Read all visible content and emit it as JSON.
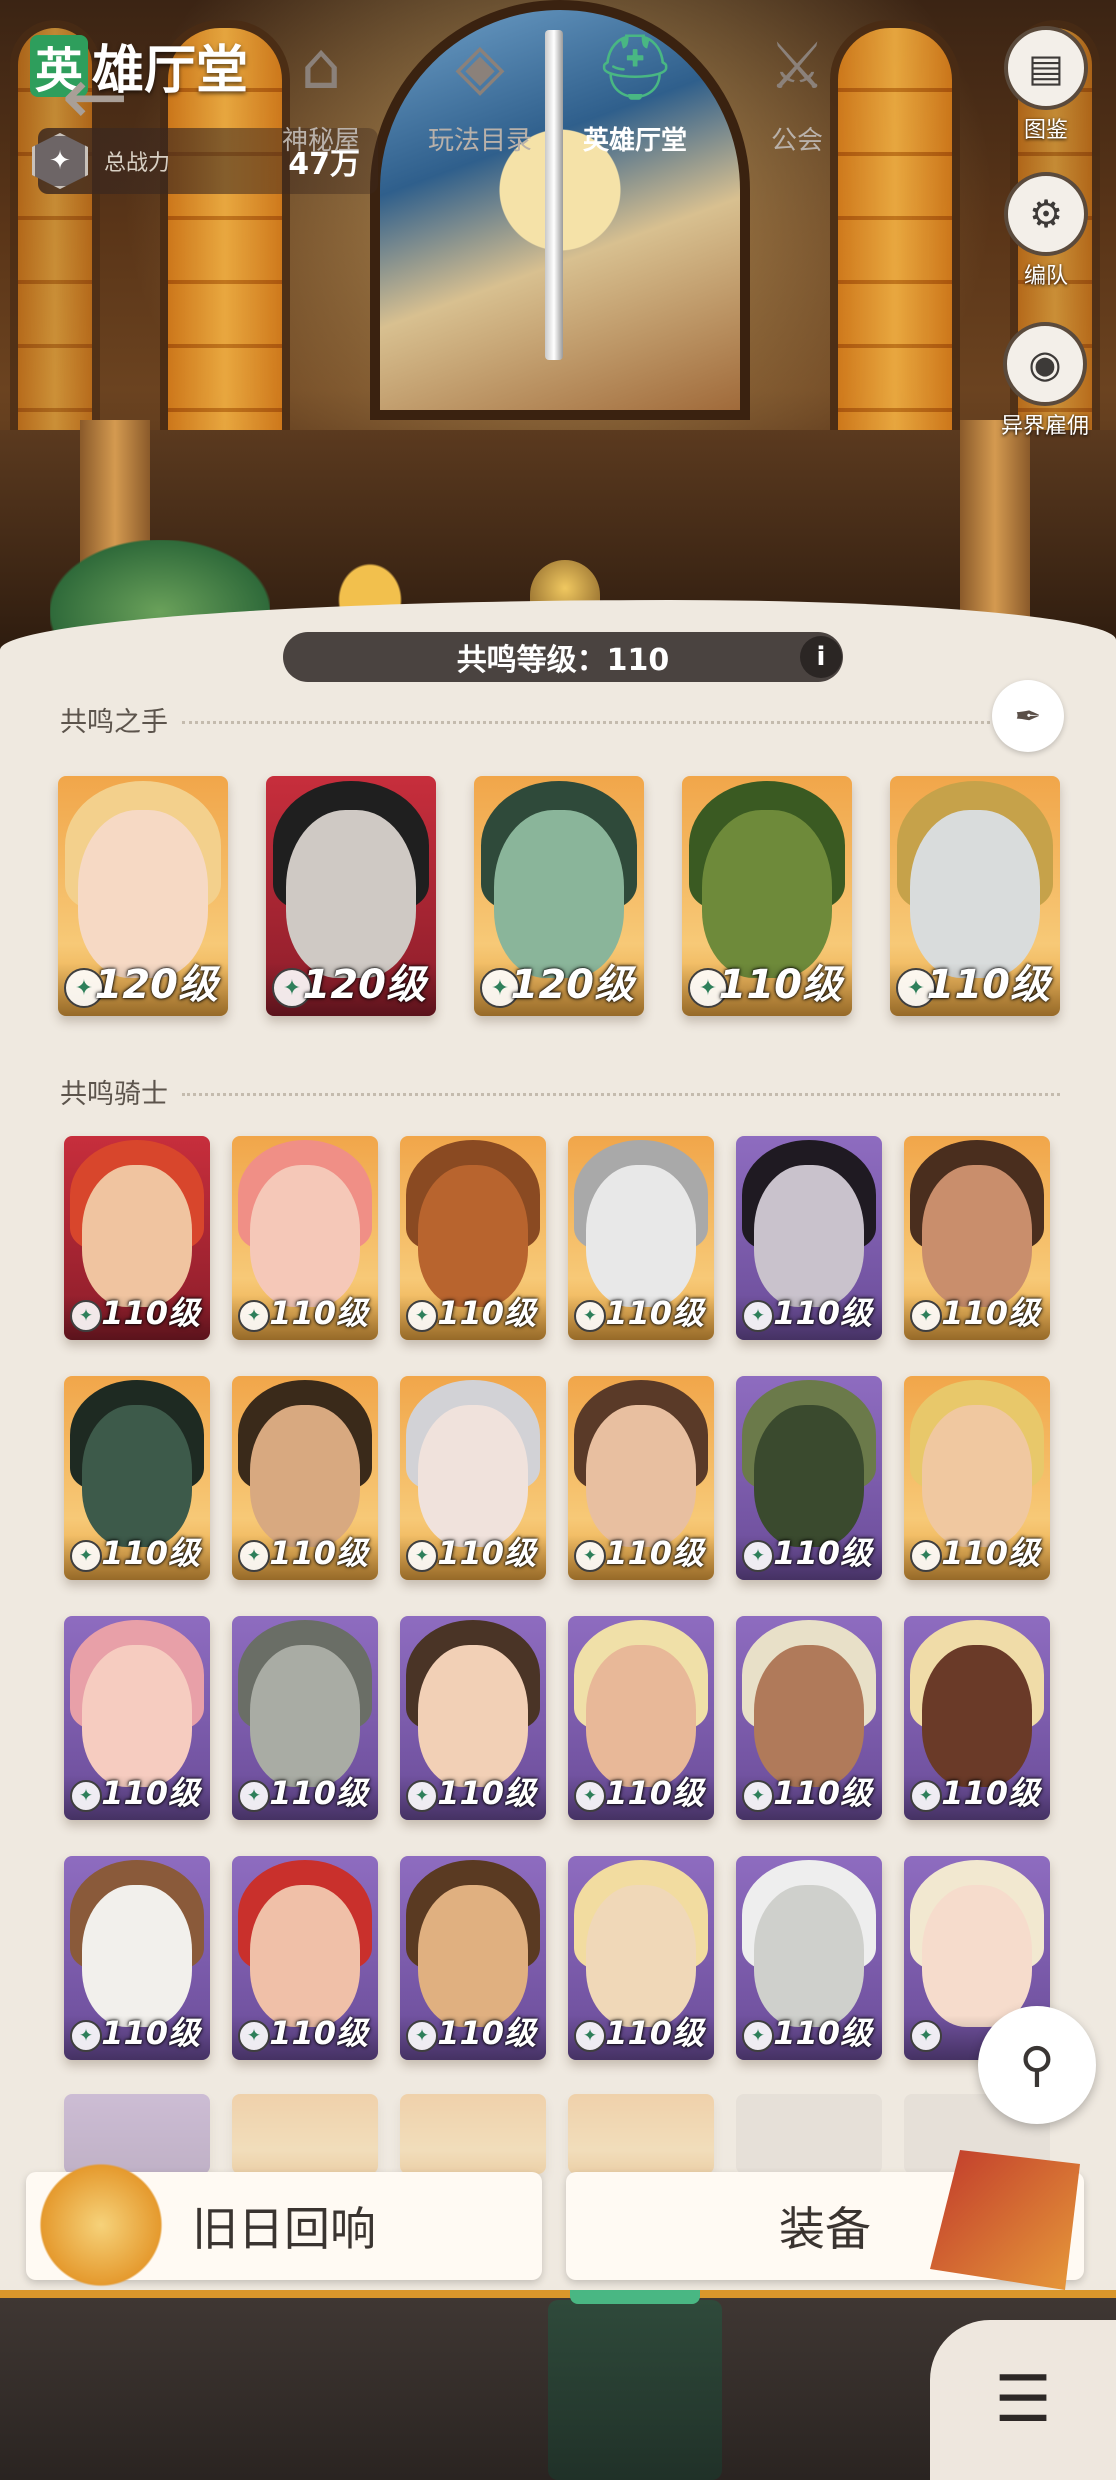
{
  "header": {
    "title_badge": "英",
    "title_rest": "雄厅堂",
    "power_label": "总战力",
    "power_value": "47万"
  },
  "side_buttons": [
    {
      "label": "图鉴",
      "icon": "book-icon"
    },
    {
      "label": "编队",
      "icon": "team-gear-icon"
    },
    {
      "label": "异界雇佣",
      "icon": "hire-icon"
    }
  ],
  "resonance": {
    "label": "共鸣等级：110",
    "info": "i"
  },
  "sections": {
    "hands": "共鸣之手",
    "knights": "共鸣骑士"
  },
  "hands": [
    {
      "level": "120级",
      "bg": "gold",
      "skin": "#f6d9c4",
      "hair": "#f3d08c"
    },
    {
      "level": "120级",
      "bg": "red",
      "skin": "#cfc9c4",
      "hair": "#1f1f1f"
    },
    {
      "level": "120级",
      "bg": "gold",
      "skin": "#8ab59a",
      "hair": "#2f4a3a"
    },
    {
      "level": "110级",
      "bg": "gold",
      "skin": "#6e8a3a",
      "hair": "#3a5a22"
    },
    {
      "level": "110级",
      "bg": "gold",
      "skin": "#d9dcdc",
      "hair": "#c6a24a"
    }
  ],
  "knights": [
    {
      "level": "110级",
      "bg": "red",
      "skin": "#f0c4a0",
      "hair": "#d8462c"
    },
    {
      "level": "110级",
      "bg": "gold",
      "skin": "#f5c8b8",
      "hair": "#f08f86"
    },
    {
      "level": "110级",
      "bg": "gold",
      "skin": "#b8642e",
      "hair": "#8a4a22"
    },
    {
      "level": "110级",
      "bg": "gold",
      "skin": "#e8e8e8",
      "hair": "#a9a9a9"
    },
    {
      "level": "110级",
      "bg": "purple",
      "skin": "#c9c2cc",
      "hair": "#1f1a22"
    },
    {
      "level": "110级",
      "bg": "gold",
      "skin": "#c98e6c",
      "hair": "#4a2e1e"
    },
    {
      "level": "110级",
      "bg": "gold",
      "skin": "#3d5a4a",
      "hair": "#1e2a22"
    },
    {
      "level": "110级",
      "bg": "gold",
      "skin": "#d8a980",
      "hair": "#3a2a1a"
    },
    {
      "level": "110级",
      "bg": "gold",
      "skin": "#f0e2dc",
      "hair": "#d2d2d6"
    },
    {
      "level": "110级",
      "bg": "gold",
      "skin": "#e8bfa0",
      "hair": "#5a3a28"
    },
    {
      "level": "110级",
      "bg": "purple",
      "skin": "#3a4a2e",
      "hair": "#6b7a4a"
    },
    {
      "level": "110级",
      "bg": "gold",
      "skin": "#f0c8a0",
      "hair": "#e8c86a"
    },
    {
      "level": "110级",
      "bg": "purple",
      "skin": "#f6ccc0",
      "hair": "#e8a0a8"
    },
    {
      "level": "110级",
      "bg": "purple",
      "skin": "#a9aca4",
      "hair": "#6a6e66"
    },
    {
      "level": "110级",
      "bg": "purple",
      "skin": "#f2d0b6",
      "hair": "#4a3426"
    },
    {
      "level": "110级",
      "bg": "purple",
      "skin": "#e8b898",
      "hair": "#f0e0a8"
    },
    {
      "level": "110级",
      "bg": "purple",
      "skin": "#b07a5a",
      "hair": "#e8e0c8"
    },
    {
      "level": "110级",
      "bg": "purple",
      "skin": "#6a3a28",
      "hair": "#f0dca8"
    },
    {
      "level": "110级",
      "bg": "purple",
      "skin": "#f2f0ec",
      "hair": "#8a5a3a"
    },
    {
      "level": "110级",
      "bg": "purple",
      "skin": "#f0c0a8",
      "hair": "#c9302c"
    },
    {
      "level": "110级",
      "bg": "purple",
      "skin": "#e0b080",
      "hair": "#5a3a22"
    },
    {
      "level": "110级",
      "bg": "purple",
      "skin": "#f0d8b8",
      "hair": "#f2dca0"
    },
    {
      "level": "110级",
      "bg": "purple",
      "skin": "#cfd0cc",
      "hair": "#eeeeee"
    },
    {
      "level": "1",
      "bg": "purple",
      "skin": "#f6dccc",
      "hair": "#f2e8d0"
    }
  ],
  "actions": {
    "echo": "旧日回响",
    "equip": "装备"
  },
  "nav": {
    "back": "←",
    "items": [
      "神秘屋",
      "玩法目录",
      "英雄厅堂",
      "公会"
    ],
    "menu": "☰"
  }
}
